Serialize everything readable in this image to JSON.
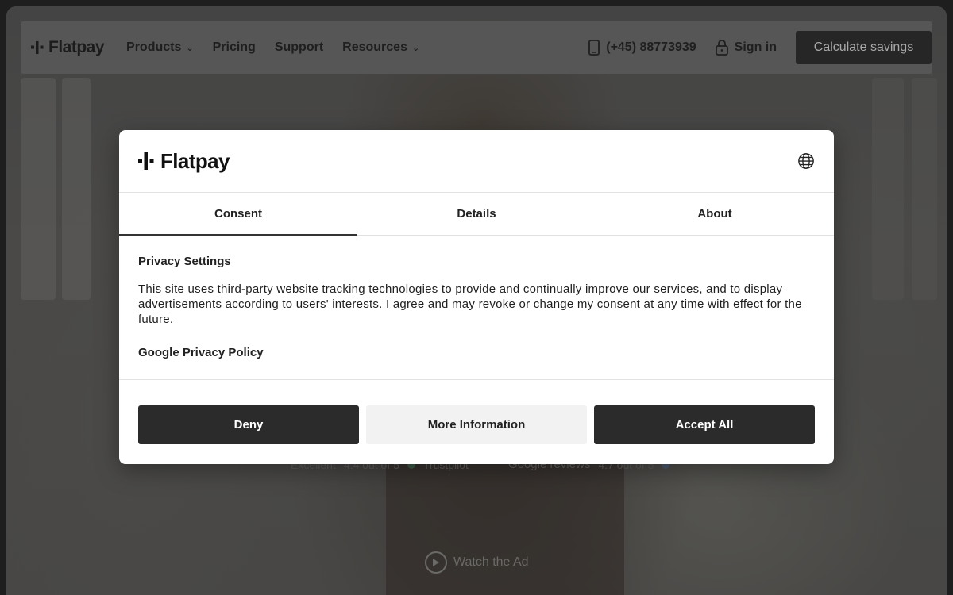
{
  "nav": {
    "logo_text": "Flatpay",
    "links": [
      {
        "label": "Products",
        "dropdown": true
      },
      {
        "label": "Pricing",
        "dropdown": false
      },
      {
        "label": "Support",
        "dropdown": false
      },
      {
        "label": "Resources",
        "dropdown": true
      }
    ],
    "phone": "(+45) 88773939",
    "signin": "Sign in",
    "cta": "Calculate savings"
  },
  "hero": {
    "rating1_label": "Excellent",
    "rating1_score": "4.4 out of 5",
    "rating1_brand": "Trustpilot",
    "rating2_brand": "Google reviews",
    "rating2_score": "4.7 out of 5",
    "watch_label": "Watch the Ad"
  },
  "modal": {
    "logo_text": "Flatpay",
    "tabs": [
      {
        "label": "Consent",
        "active": true
      },
      {
        "label": "Details",
        "active": false
      },
      {
        "label": "About",
        "active": false
      }
    ],
    "section_title": "Privacy Settings",
    "body_text": "This site uses third-party website tracking technologies to provide and continually improve our services, and to display advertisements according to users' interests. I agree and may revoke or change my consent at any time with effect for the future.",
    "policy_link": "Google Privacy Policy",
    "buttons": {
      "deny": "Deny",
      "more_info": "More Information",
      "accept_all": "Accept All"
    }
  },
  "colors": {
    "overlay_bg": "#4a4947",
    "modal_bg": "#ffffff",
    "dark_button": "#2b2b2b",
    "light_button": "#f2f2f2",
    "cta_bg": "#262626"
  }
}
